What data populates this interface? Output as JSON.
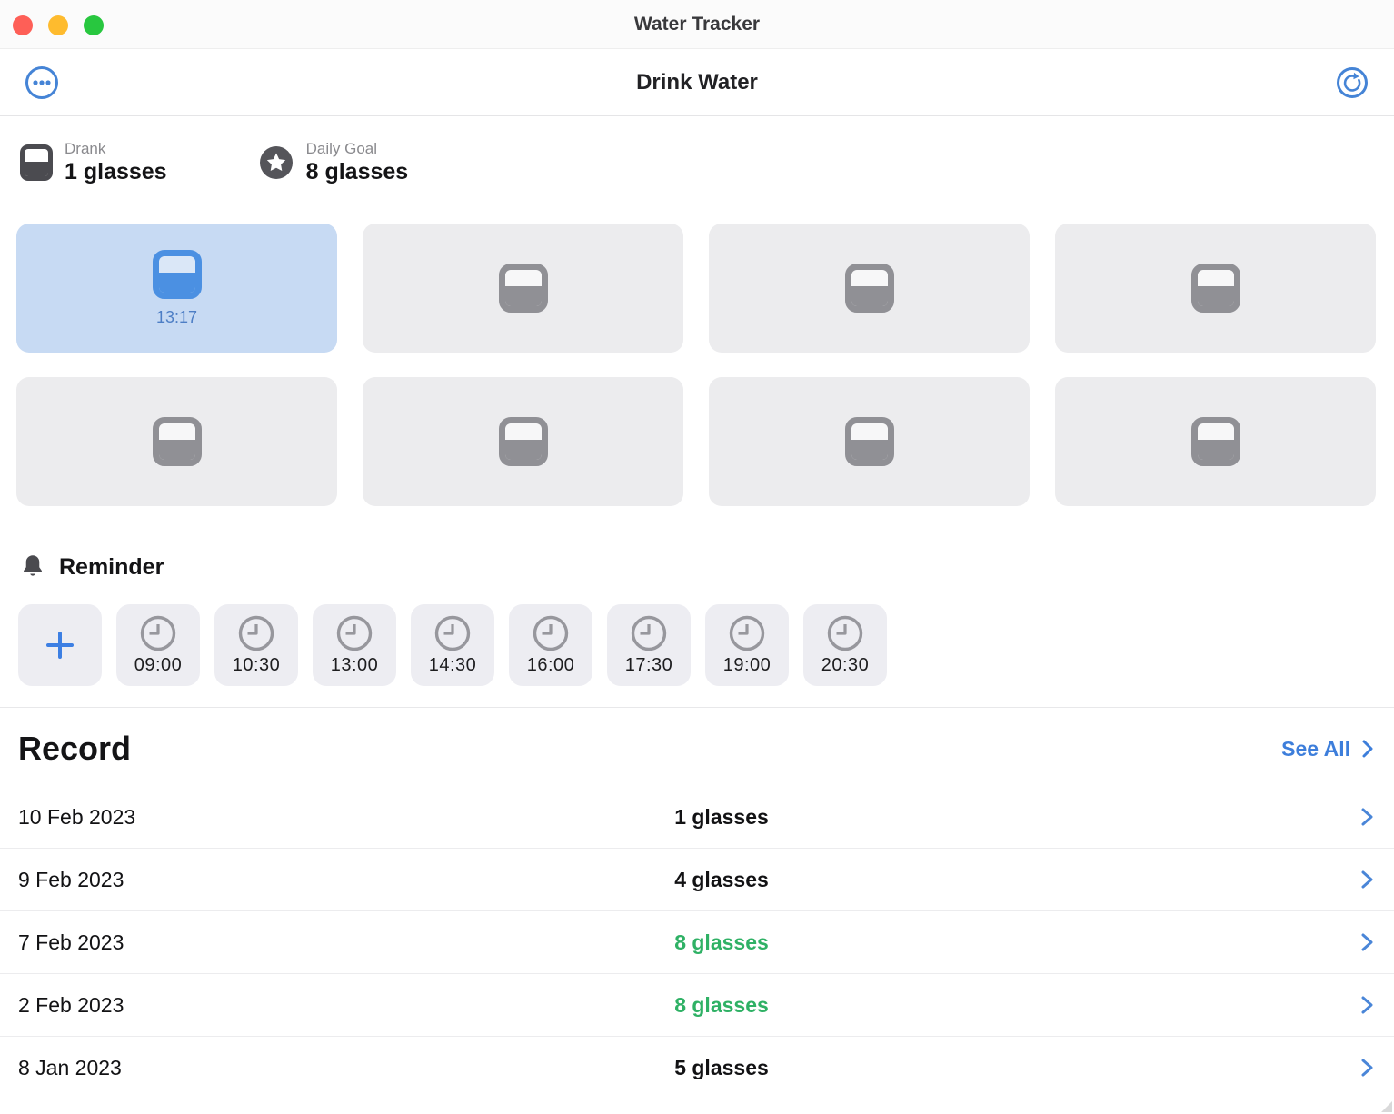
{
  "window": {
    "title": "Water Tracker"
  },
  "toolbar": {
    "title": "Drink Water"
  },
  "stats": {
    "drank": {
      "label": "Drank",
      "value": "1 glasses",
      "icon": "glass-icon"
    },
    "daily_goal": {
      "label": "Daily Goal",
      "value": "8 glasses",
      "icon": "star-circle-icon"
    }
  },
  "glasses_grid": {
    "cells": [
      {
        "state": "filled",
        "time": "13:17"
      },
      {
        "state": "empty",
        "time": ""
      },
      {
        "state": "empty",
        "time": ""
      },
      {
        "state": "empty",
        "time": ""
      },
      {
        "state": "empty",
        "time": ""
      },
      {
        "state": "empty",
        "time": ""
      },
      {
        "state": "empty",
        "time": ""
      },
      {
        "state": "empty",
        "time": ""
      }
    ]
  },
  "reminder": {
    "title": "Reminder",
    "icon": "bell-icon",
    "add_label": "+",
    "times": [
      "09:00",
      "10:30",
      "13:00",
      "14:30",
      "16:00",
      "17:30",
      "19:00",
      "20:30"
    ]
  },
  "record": {
    "title": "Record",
    "see_all_label": "See All",
    "rows": [
      {
        "date": "10 Feb 2023",
        "value": "1 glasses",
        "goal_met": false
      },
      {
        "date": "9 Feb 2023",
        "value": "4 glasses",
        "goal_met": false
      },
      {
        "date": "7 Feb 2023",
        "value": "8 glasses",
        "goal_met": true
      },
      {
        "date": "2 Feb 2023",
        "value": "8 glasses",
        "goal_met": true
      },
      {
        "date": "8 Jan 2023",
        "value": "5 glasses",
        "goal_met": false
      }
    ]
  },
  "colors": {
    "accent_blue": "#4584d6",
    "filled_card_bg": "#c7daf3",
    "glass_blue": "#4b90e2",
    "time_blue": "#4d7ec5",
    "empty_card_bg": "#ececee",
    "glass_gray": "#909095",
    "chip_bg": "#ededf2",
    "goal_green": "#2fb165",
    "see_all_blue": "#3d7edb",
    "traffic_red": "#fe5f57",
    "traffic_yellow": "#febb2e",
    "traffic_green": "#28c73f"
  }
}
